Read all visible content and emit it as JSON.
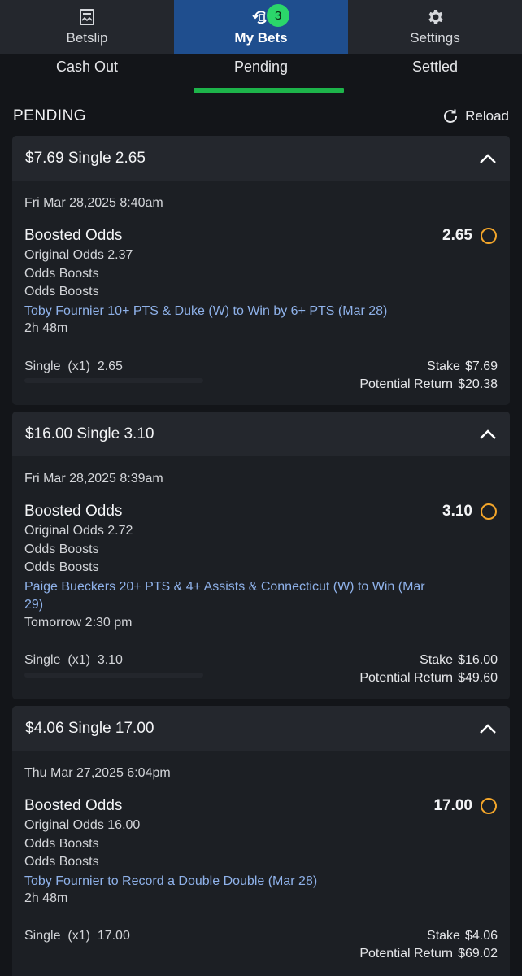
{
  "nav": {
    "items": [
      {
        "label": "Betslip",
        "icon": "betslip-icon"
      },
      {
        "label": "My Bets",
        "icon": "my-bets-icon",
        "badge": "3"
      },
      {
        "label": "Settings",
        "icon": "gear-icon"
      }
    ]
  },
  "tabs": [
    "Cash Out",
    "Pending",
    "Settled"
  ],
  "section": {
    "title": "PENDING",
    "reload_label": "Reload"
  },
  "colors": {
    "accent_blue": "#1f4e8e",
    "active_green": "#1db44a",
    "pending_orange": "#f4a62a",
    "link_blue": "#8fb2ea"
  },
  "bets": [
    {
      "title": "$7.69 Single 2.65",
      "date": "Fri Mar 28,2025 8:40am",
      "type": "Boosted Odds",
      "odds": "2.65",
      "original_odds": "Original Odds 2.37",
      "boost1": "Odds Boosts",
      "boost2": "Odds Boosts",
      "selection": "Toby Fournier 10+ PTS & Duke (W) to Win by 6+ PTS (Mar 28)",
      "time": "2h 48m",
      "summary": "Single  (x1)  2.65",
      "stake_label": "Stake",
      "stake": "$7.69",
      "return_label": "Potential Return",
      "return": "$20.38"
    },
    {
      "title": "$16.00 Single 3.10",
      "date": "Fri Mar 28,2025 8:39am",
      "type": "Boosted Odds",
      "odds": "3.10",
      "original_odds": "Original Odds 2.72",
      "boost1": "Odds Boosts",
      "boost2": "Odds Boosts",
      "selection": "Paige Bueckers 20+ PTS & 4+ Assists & Connecticut (W) to Win (Mar 29)",
      "time": "Tomorrow 2:30 pm",
      "summary": "Single  (x1)  3.10",
      "stake_label": "Stake",
      "stake": "$16.00",
      "return_label": "Potential Return",
      "return": "$49.60"
    },
    {
      "title": "$4.06 Single 17.00",
      "date": "Thu Mar 27,2025 6:04pm",
      "type": "Boosted Odds",
      "odds": "17.00",
      "original_odds": "Original Odds 16.00",
      "boost1": "Odds Boosts",
      "boost2": "Odds Boosts",
      "selection": "Toby Fournier to Record a Double Double (Mar 28)",
      "time": "2h 48m",
      "summary": "Single  (x1)  17.00",
      "stake_label": "Stake",
      "stake": "$4.06",
      "return_label": "Potential Return",
      "return": "$69.02"
    }
  ]
}
